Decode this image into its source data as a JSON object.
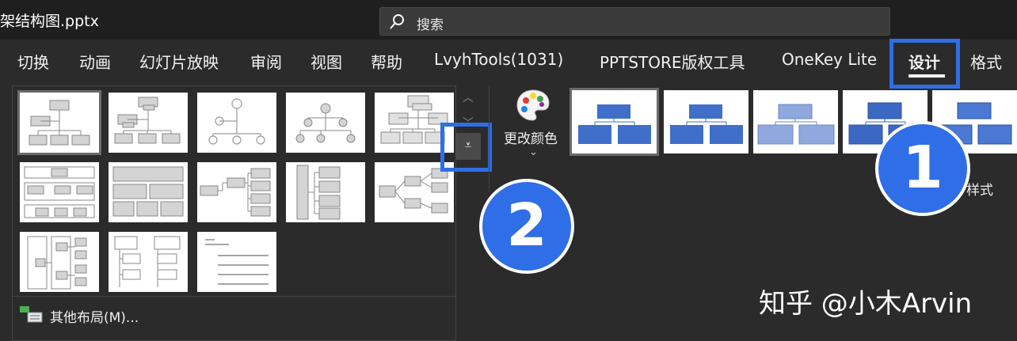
{
  "window": {
    "filename": "架结构图.pptx"
  },
  "search": {
    "label": "搜索"
  },
  "tabs": [
    "切换",
    "动画",
    "幻灯片放映",
    "审阅",
    "视图",
    "帮助",
    "LvyhTools(1031)",
    "PPTSTORE版权工具",
    "OneKey Lite",
    "设计",
    "格式"
  ],
  "active_tab": "设计",
  "layouts": {
    "more_label": "其他布局(M)..."
  },
  "change_colors": {
    "label": "更改颜色"
  },
  "styles": {
    "label": "样式"
  },
  "badges": [
    "1",
    "2"
  ],
  "watermark": "知乎 @小木Arvin",
  "colors": {
    "accent": "#2f6ee6",
    "shape_blue": "#3f6fc8",
    "shape_light": "#8fa8de"
  }
}
